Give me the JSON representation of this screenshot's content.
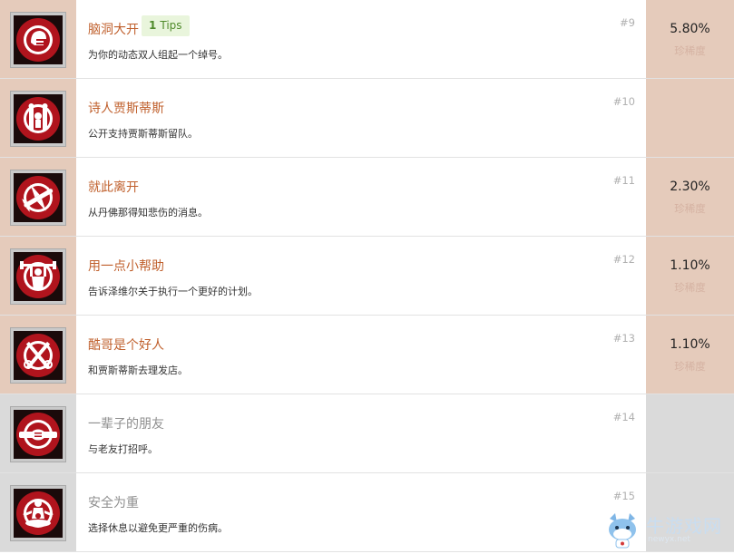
{
  "achievements": [
    {
      "title": "脑洞大开",
      "desc": "为你的动态双人组起一个绰号。",
      "number": "#9",
      "tips": {
        "count": "1",
        "label": "Tips"
      },
      "percent": "5.80%",
      "rarity": "珍稀度",
      "locked": false,
      "icon": "helmet-icon"
    },
    {
      "title": "诗人贾斯蒂斯",
      "desc": "公开支持贾斯蒂斯留队。",
      "number": "#10",
      "percent": "",
      "rarity": "",
      "locked": false,
      "icon": "cheer-icon"
    },
    {
      "title": "就此离开",
      "desc": "从丹佛那得知悲伤的消息。",
      "number": "#11",
      "percent": "2.30%",
      "rarity": "珍稀度",
      "locked": false,
      "icon": "airplane-icon"
    },
    {
      "title": "用一点小帮助",
      "desc": "告诉泽维尔关于执行一个更好的计划。",
      "number": "#12",
      "percent": "1.10%",
      "rarity": "珍稀度",
      "locked": false,
      "icon": "weightlifter-icon"
    },
    {
      "title": "酷哥是个好人",
      "desc": "和贾斯蒂斯去理发店。",
      "number": "#13",
      "percent": "1.10%",
      "rarity": "珍稀度",
      "locked": false,
      "icon": "barber-tools-icon"
    },
    {
      "title": "一辈子的朋友",
      "desc": "与老友打招呼。",
      "number": "#14",
      "percent": "",
      "rarity": "",
      "locked": true,
      "icon": "handshake-icon"
    },
    {
      "title": "安全为重",
      "desc": "选择休息以避免更严重的伤病。",
      "number": "#15",
      "percent": "",
      "rarity": "",
      "locked": true,
      "icon": "meditation-icon"
    }
  ],
  "watermark": {
    "text": "牛游戏网",
    "url": "newyx.net"
  },
  "colors": {
    "title": "#c0602d",
    "locked_title": "#8f8f8f",
    "side_panel": "#e5cbbb",
    "locked_panel": "#dadada",
    "badge_red": "#b0141d",
    "tips_bg": "#e9f5dc",
    "tips_text": "#4f8a2a"
  }
}
